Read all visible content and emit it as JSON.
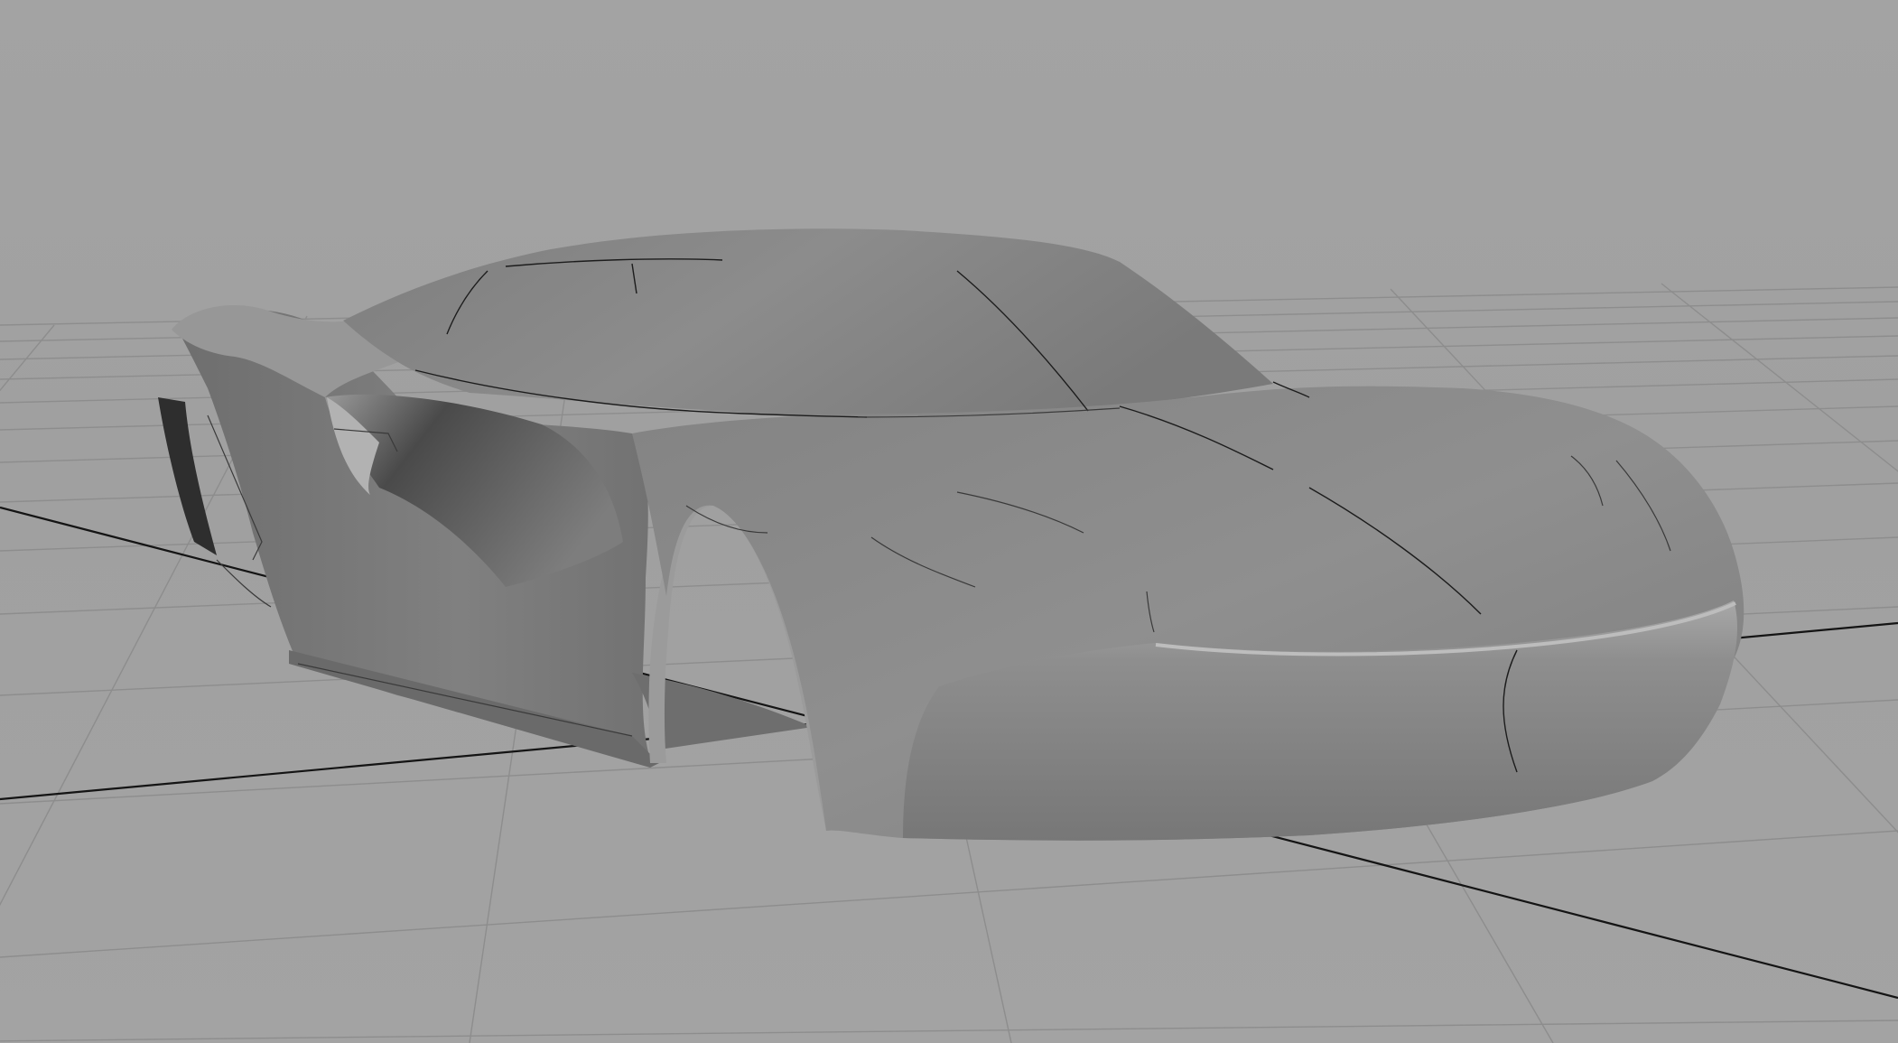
{
  "viewport": {
    "background_color": "#a0a0a0",
    "grid_color": "#8d8d8d",
    "axis_color": "#141414"
  },
  "model": {
    "shading": "smooth",
    "surface_color": "#8a8a8a",
    "shadow_color": "#4a4a4a",
    "highlight_color": "#b4b4b4",
    "isoparm_color": "#1c1c1c"
  }
}
